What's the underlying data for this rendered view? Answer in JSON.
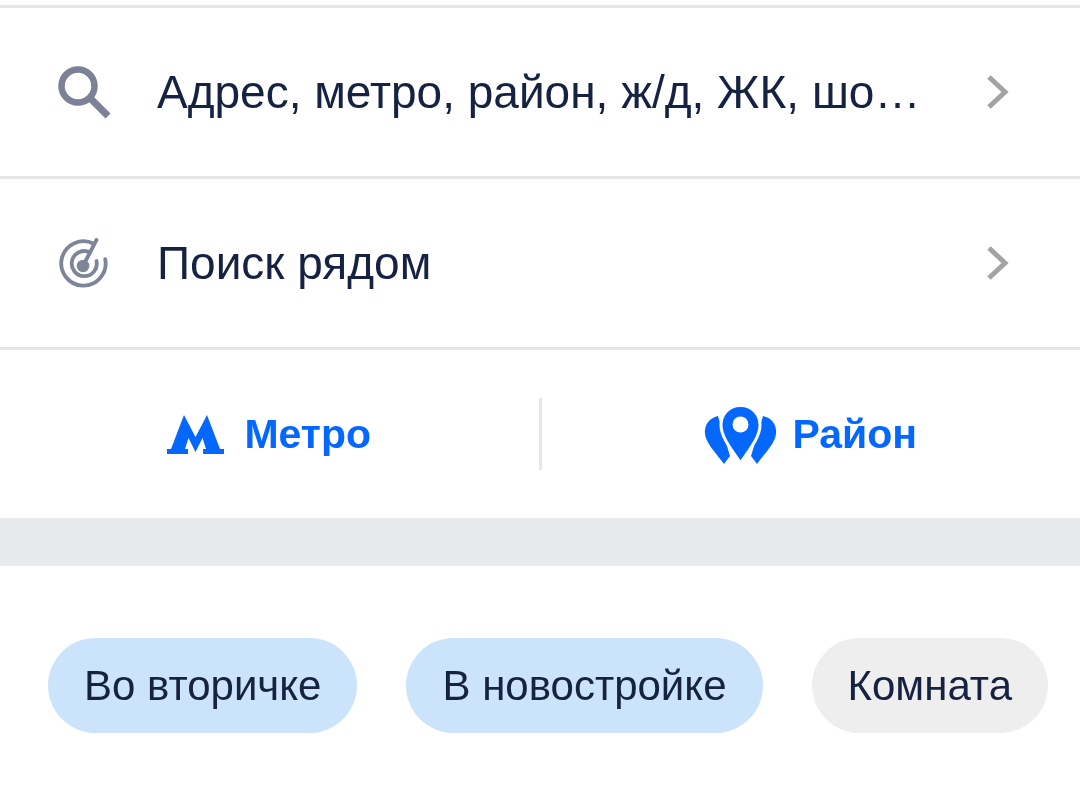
{
  "search_rows": [
    {
      "kind": "address",
      "label": "Адрес, метро, район, ж/д, ЖК, шо…"
    },
    {
      "kind": "nearby",
      "label": "Поиск рядом"
    }
  ],
  "quick_links": [
    {
      "kind": "metro",
      "label": "Метро"
    },
    {
      "kind": "district",
      "label": "Район"
    }
  ],
  "filter_chips": [
    {
      "label": "Во вторичке",
      "selected": true
    },
    {
      "label": "В новостройке",
      "selected": true
    },
    {
      "label": "Комната",
      "selected": false
    }
  ]
}
